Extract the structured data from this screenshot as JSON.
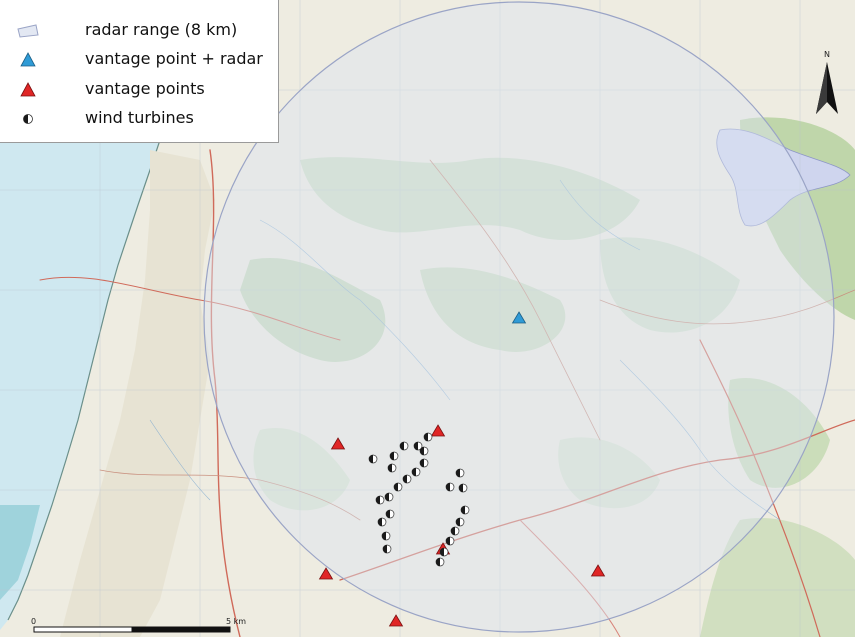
{
  "legend": {
    "items": [
      {
        "symbol": "radar-range",
        "label": "radar range (8 km)"
      },
      {
        "symbol": "blue-triangle",
        "label": "vantage point + radar"
      },
      {
        "symbol": "red-triangle",
        "label": "vantage points"
      },
      {
        "symbol": "half-circle",
        "label": "wind turbines"
      }
    ]
  },
  "north_arrow": {
    "letter": "N"
  },
  "scale_bar": {
    "start_label": "0",
    "end_label": "5 km"
  },
  "colors": {
    "radar_vantage": "#2f9bd6",
    "vantage_point": "#e02626",
    "turbine_dark": "#1a1a1a",
    "sea": "#cfe8f0",
    "radar_range_fill": "#dce4f2"
  },
  "map_features": {
    "radar_vantage_point_count": 1,
    "vantage_point_count": 7,
    "wind_turbine_count": 34
  }
}
